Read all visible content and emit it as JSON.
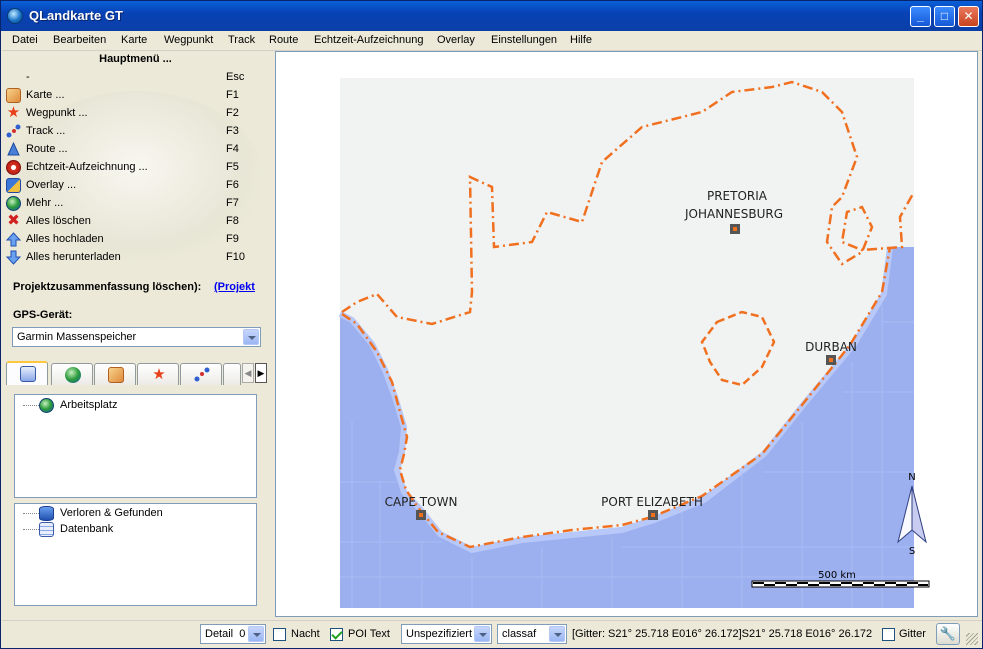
{
  "window": {
    "title": "QLandkarte GT",
    "minimize": "_",
    "maximize": "□",
    "close": "✕"
  },
  "menubar": [
    "Datei",
    "Bearbeiten",
    "Karte",
    "Wegpunkt",
    "Track",
    "Route",
    "Echtzeit-Aufzeichnung",
    "Overlay",
    "Einstellungen",
    "Hilfe"
  ],
  "main_menu": {
    "title": "Hauptmenü ...",
    "items": [
      {
        "label": "-",
        "key": "Esc",
        "icon": "none"
      },
      {
        "label": "Karte ...",
        "key": "F1",
        "icon": "map-icon"
      },
      {
        "label": "Wegpunkt ...",
        "key": "F2",
        "icon": "waypoint-star-icon"
      },
      {
        "label": "Track ...",
        "key": "F3",
        "icon": "track-icon"
      },
      {
        "label": "Route ...",
        "key": "F4",
        "icon": "route-icon"
      },
      {
        "label": "Echtzeit-Aufzeichnung ...",
        "key": "F5",
        "icon": "live-log-icon"
      },
      {
        "label": "Overlay ...",
        "key": "F6",
        "icon": "overlay-icon"
      },
      {
        "label": "Mehr ...",
        "key": "F7",
        "icon": "more-globe-icon"
      },
      {
        "label": "Alles löschen",
        "key": "F8",
        "icon": "delete-icon"
      },
      {
        "label": "Alles hochladen",
        "key": "F9",
        "icon": "upload-icon"
      },
      {
        "label": "Alles herunterladen",
        "key": "F10",
        "icon": "download-icon"
      }
    ]
  },
  "project": {
    "summary_label": "Projektzusammenfassung löschen):",
    "link_text": "(Projekt"
  },
  "gps": {
    "label": "GPS-Gerät:",
    "selected": "Garmin Massenspeicher"
  },
  "tree_top": {
    "items": [
      {
        "label": "Arbeitsplatz",
        "icon": "workspace-globe-icon"
      }
    ]
  },
  "tree_bottom": {
    "items": [
      {
        "label": "Verloren & Gefunden",
        "icon": "lost-found-icon"
      },
      {
        "label": "Datenbank",
        "icon": "database-icon"
      }
    ]
  },
  "map": {
    "cities": [
      "PRETORIA",
      "JOHANNESBURG",
      "DURBAN",
      "CAPE TOWN",
      "PORT ELIZABETH"
    ],
    "scale_label": "500 km",
    "compass_n": "N",
    "compass_s": "S"
  },
  "statusbar": {
    "detail_label": "Detail",
    "detail_value": "0",
    "night_label": "Nacht",
    "night_checked": false,
    "poi_label": "POI Text",
    "poi_checked": true,
    "unspec_value": "Unspezifiziert",
    "classaf_value": "classaf",
    "grid_text": "[Gitter: S21° 25.718 E016° 26.172]S21° 25.718 E016° 26.172",
    "grid_label": "Gitter",
    "grid_checked": false
  },
  "colors": {
    "water": "#9cb0f0",
    "land": "#f1f3f2",
    "border": "#f07020",
    "titlebar": "#0842b4"
  }
}
